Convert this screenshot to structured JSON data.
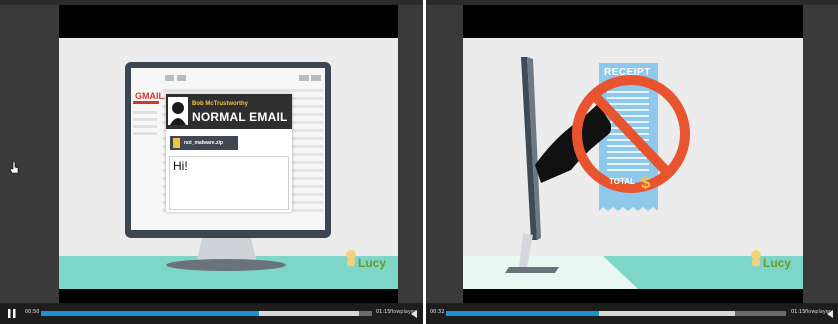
{
  "players": [
    {
      "id": "left",
      "scene": {
        "email_provider": "GMAIL",
        "sender_name": "Bob McTrustworthy",
        "email_subject": "NORMAL EMAIL",
        "attachment_name": "not_malware.zip",
        "email_body": "Hi!"
      },
      "watermark": "Lucy",
      "controls": {
        "current_time": "00:50",
        "duration": "01:15",
        "brand": "flowplayer",
        "progress": 0.66,
        "buffered": 0.96
      }
    },
    {
      "id": "right",
      "scene": {
        "receipt_title": "RECEIPT",
        "total_label": "TOTAL",
        "currency_symbol": "$"
      },
      "watermark": "Lucy",
      "controls": {
        "current_time": "00:32",
        "duration": "01:15",
        "brand": "flowplayer",
        "progress": 0.45,
        "buffered": 0.85
      }
    }
  ]
}
